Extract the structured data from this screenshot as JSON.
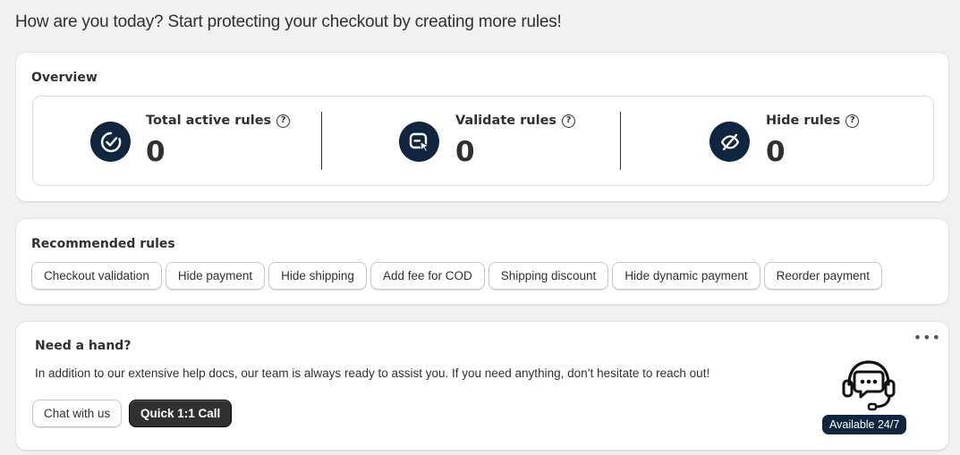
{
  "greeting": "How are you today? Start protecting your checkout by creating more rules!",
  "overview": {
    "title": "Overview",
    "stats": [
      {
        "label": "Total active rules",
        "value": "0",
        "icon": "check-circle-icon"
      },
      {
        "label": "Validate rules",
        "value": "0",
        "icon": "validate-cursor-icon"
      },
      {
        "label": "Hide rules",
        "value": "0",
        "icon": "hide-eye-slash-icon"
      }
    ],
    "help_glyph": "?"
  },
  "recommended": {
    "title": "Recommended rules",
    "chips": [
      "Checkout validation",
      "Hide payment",
      "Hide shipping",
      "Add fee for COD",
      "Shipping discount",
      "Hide dynamic payment",
      "Reorder payment"
    ]
  },
  "help": {
    "title": "Need a hand?",
    "description": "In addition to our extensive help docs, our team is always ready to assist you. If you need anything, don’t hesitate to reach out!",
    "chat_label": "Chat with us",
    "call_label": "Quick 1:1 Call",
    "more_glyph": "•••",
    "badge": "Available 24/7",
    "icon": "headset-chat-icon"
  },
  "colors": {
    "accent_navy": "#0f2540",
    "primary_button": "#303030",
    "background": "#f1f1f1"
  }
}
